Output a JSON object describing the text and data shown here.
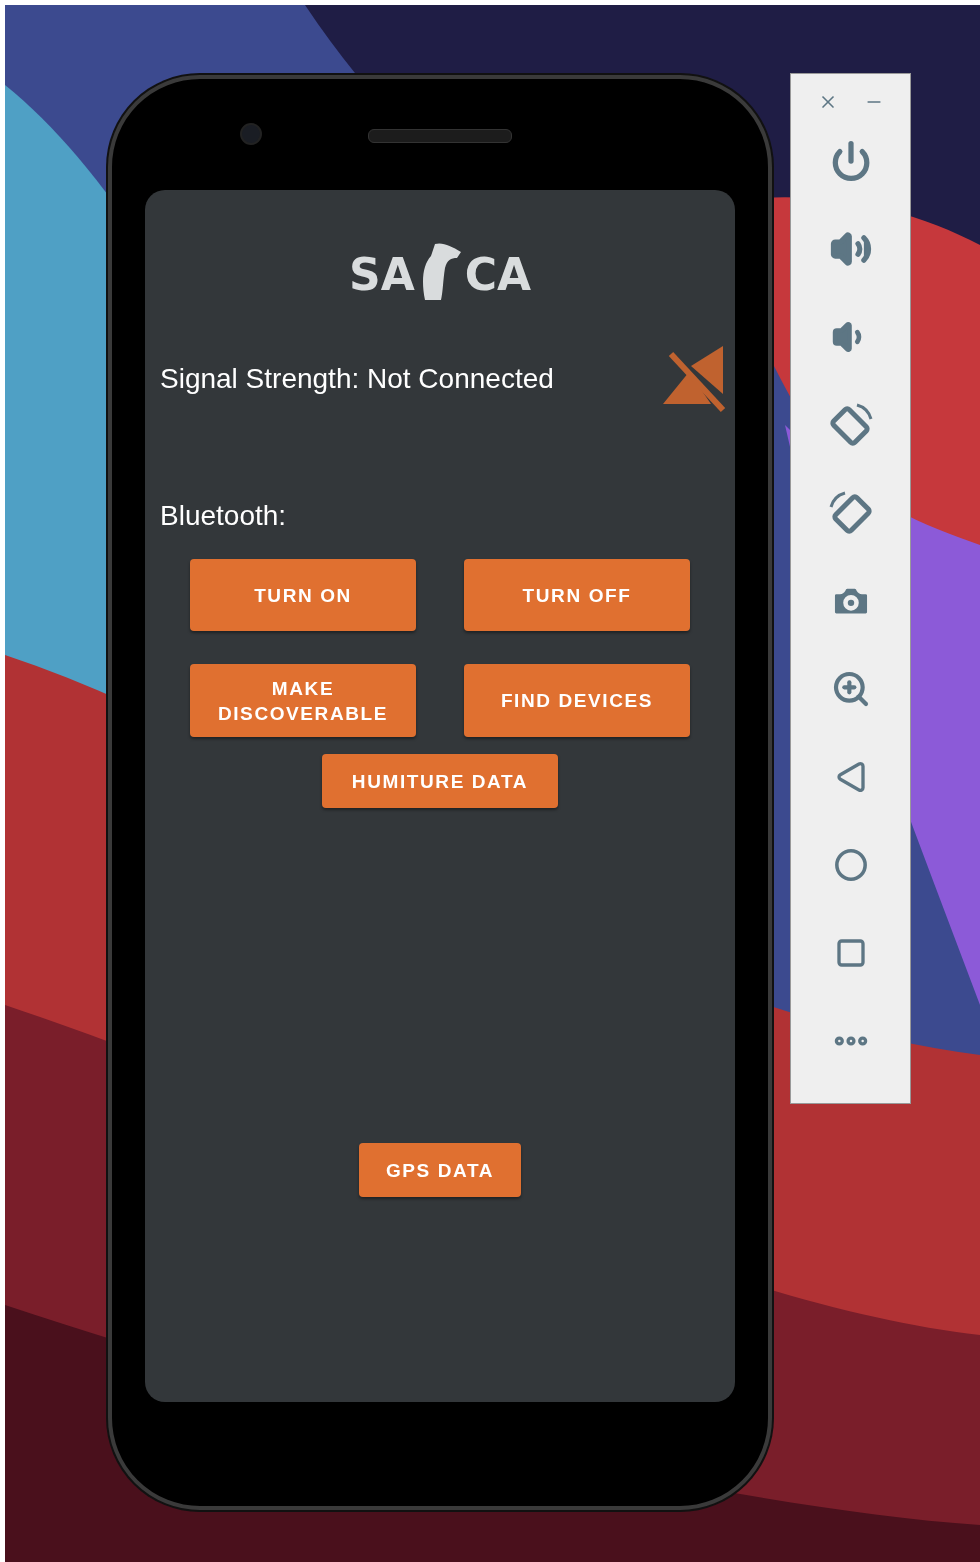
{
  "logo": {
    "left": "SA",
    "right": "CA"
  },
  "signal": {
    "label": "Signal Strength: Not Connected",
    "connected": false
  },
  "bluetooth": {
    "label": "Bluetooth:",
    "buttons": [
      {
        "label": "TURN ON"
      },
      {
        "label": "TURN OFF"
      },
      {
        "label": "MAKE DISCOVERABLE"
      },
      {
        "label": "FIND DEVICES"
      }
    ]
  },
  "humiture_button": {
    "label": "HUMITURE DATA"
  },
  "gps_button": {
    "label": "GPS DATA"
  }
}
